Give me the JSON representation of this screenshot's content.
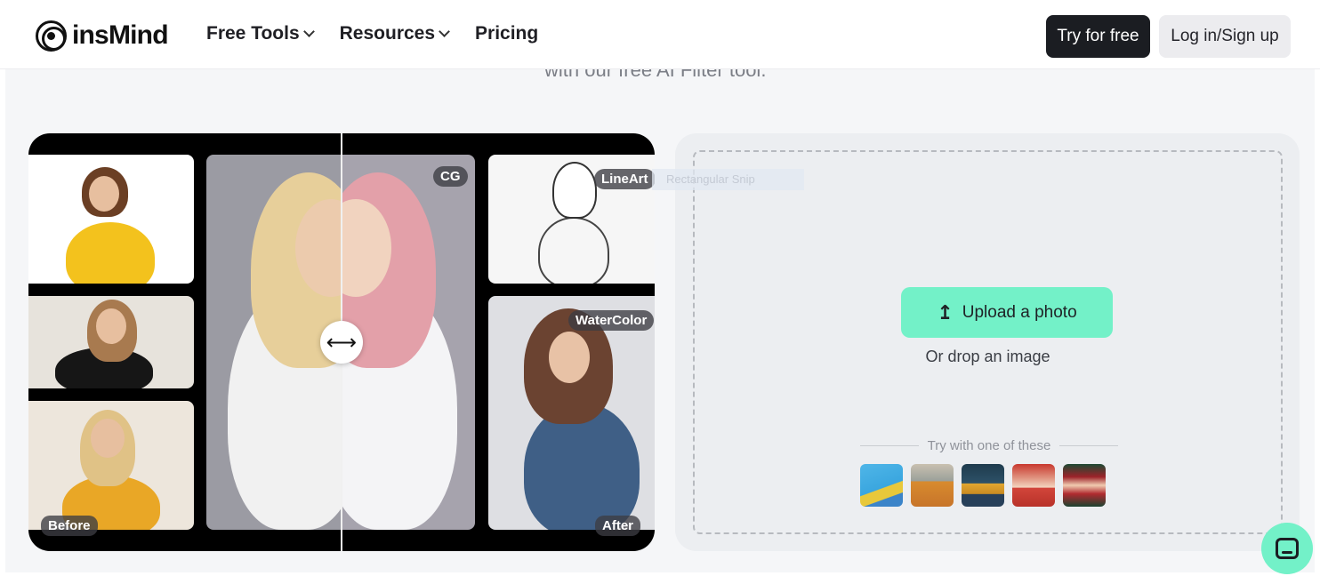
{
  "header": {
    "logo_text": "insMind",
    "nav": [
      {
        "label": "Free Tools",
        "has_dropdown": true
      },
      {
        "label": "Resources",
        "has_dropdown": true
      },
      {
        "label": "Pricing",
        "has_dropdown": false
      }
    ],
    "try_label": "Try for free",
    "login_label": "Log in/Sign up"
  },
  "hero": {
    "subtitle": "with our free AI Filter tool."
  },
  "showcase": {
    "labels": {
      "before": "Before",
      "after": "After",
      "cg": "CG",
      "lineart": "LineArt",
      "watercolor": "WaterColor"
    },
    "slider_glyph": "⟷"
  },
  "upload": {
    "button_label": "Upload a photo",
    "upload_icon": "↥",
    "drop_text": "Or drop an image",
    "try_label": "Try with one of these"
  },
  "overlay": {
    "snip_label": "Rectangular Snip"
  },
  "colors": {
    "accent": "#73f1c8",
    "dark": "#1b1d22"
  }
}
